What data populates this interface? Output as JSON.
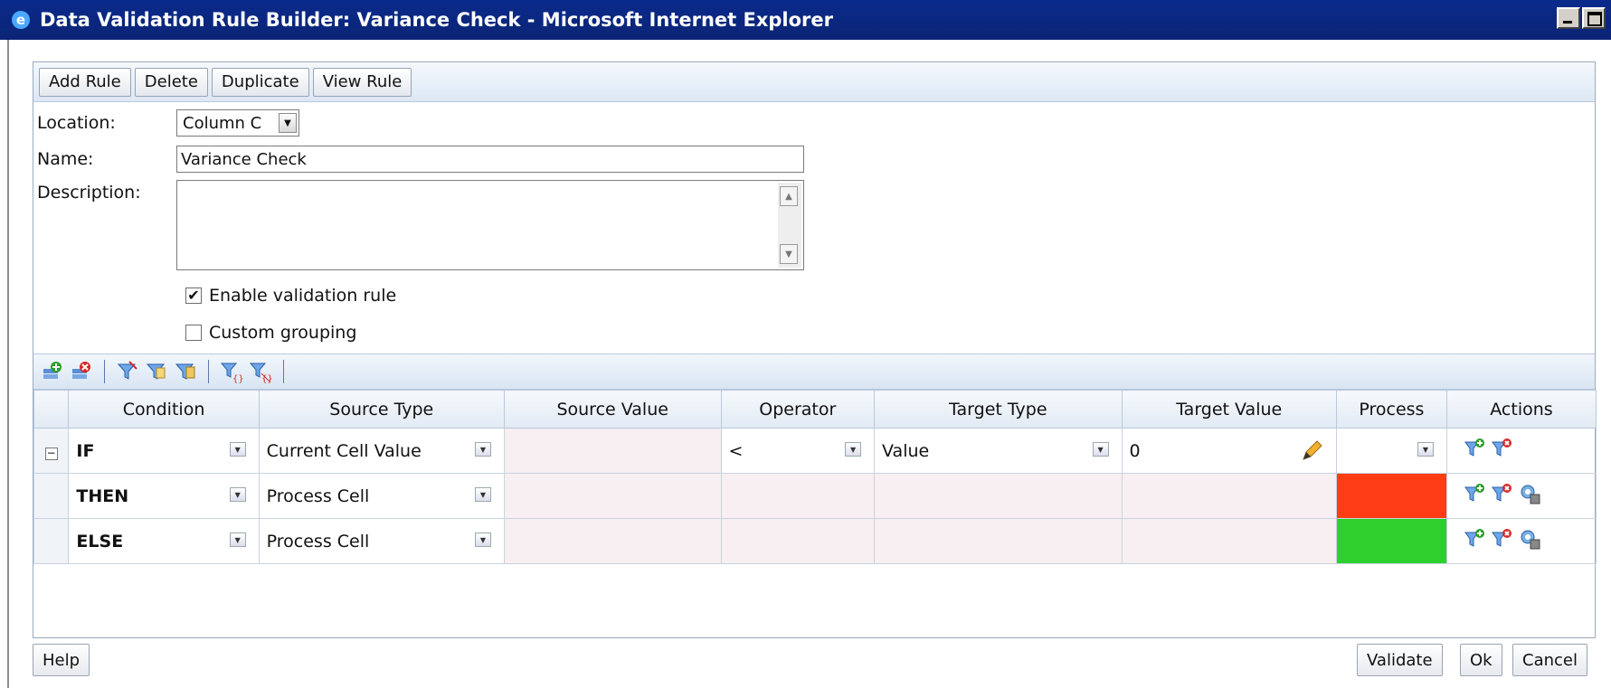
{
  "window": {
    "title": "Data Validation Rule Builder: Variance Check - Microsoft Internet Explorer"
  },
  "toolbar": {
    "add_rule": "Add Rule",
    "delete": "Delete",
    "duplicate": "Duplicate",
    "view_rule": "View Rule"
  },
  "form": {
    "location_label": "Location:",
    "location_value": "Column C",
    "name_label": "Name:",
    "name_value": "Variance Check",
    "description_label": "Description:",
    "description_value": "",
    "enable_label": "Enable validation rule",
    "enable_checked": true,
    "custom_grouping_label": "Custom grouping",
    "custom_grouping_checked": false
  },
  "grid_toolbar_icons": [
    "add-condition-icon",
    "delete-condition-icon",
    "insert-filter-icon",
    "copy-filter-icon",
    "paste-filter-icon",
    "group-filter-icon",
    "ungroup-filter-icon"
  ],
  "grid": {
    "columns": [
      "Condition",
      "Source Type",
      "Source Value",
      "Operator",
      "Target Type",
      "Target Value",
      "Process",
      "Actions"
    ],
    "rows": [
      {
        "condition": "IF",
        "source_type": "Current Cell Value",
        "source_value": "",
        "operator": "<",
        "target_type": "Value",
        "target_value": "0",
        "process_color": "",
        "actions": [
          "add-condition-icon",
          "delete-condition-icon"
        ]
      },
      {
        "condition": "THEN",
        "source_type": "Process Cell",
        "source_value": "",
        "operator": "",
        "target_type": "",
        "target_value": "",
        "process_color": "#ff3c14",
        "actions": [
          "add-condition-icon",
          "delete-condition-icon",
          "process-settings-icon"
        ]
      },
      {
        "condition": "ELSE",
        "source_type": "Process Cell",
        "source_value": "",
        "operator": "",
        "target_type": "",
        "target_value": "",
        "process_color": "#2ed02e",
        "actions": [
          "add-condition-icon",
          "delete-condition-icon",
          "process-settings-icon"
        ]
      }
    ]
  },
  "footer": {
    "help": "Help",
    "validate": "Validate",
    "ok": "Ok",
    "cancel": "Cancel"
  }
}
